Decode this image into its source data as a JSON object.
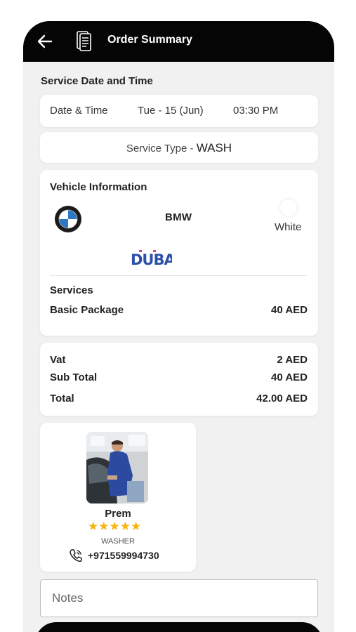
{
  "header": {
    "title": "Order Summary"
  },
  "service_date_time": {
    "section_title": "Service Date and Time",
    "label": "Date & Time",
    "date": "Tue - 15 (Jun)",
    "time": "03:30 PM"
  },
  "service_type": {
    "label": "Service Type - ",
    "value": "WASH"
  },
  "vehicle": {
    "title": "Vehicle Information",
    "brand": "BMW",
    "color_name": "White",
    "color_hex": "#ffffff",
    "plate_emirate": "DUBAI"
  },
  "services": {
    "title": "Services",
    "items": [
      {
        "name": "Basic Package",
        "price": "40 AED"
      }
    ]
  },
  "totals": {
    "vat_label": "Vat",
    "vat_value": "2 AED",
    "subtotal_label": "Sub Total",
    "subtotal_value": "40 AED",
    "total_label": "Total",
    "total_value": "42.00 AED"
  },
  "washer": {
    "name": "Prem",
    "rating": 5,
    "role": "WASHER",
    "phone": "+971559994730"
  },
  "notes": {
    "placeholder": "Notes",
    "value": ""
  },
  "colors": {
    "appbar": "#050505",
    "background": "#f1f1f1",
    "star": "#f5b50a"
  }
}
